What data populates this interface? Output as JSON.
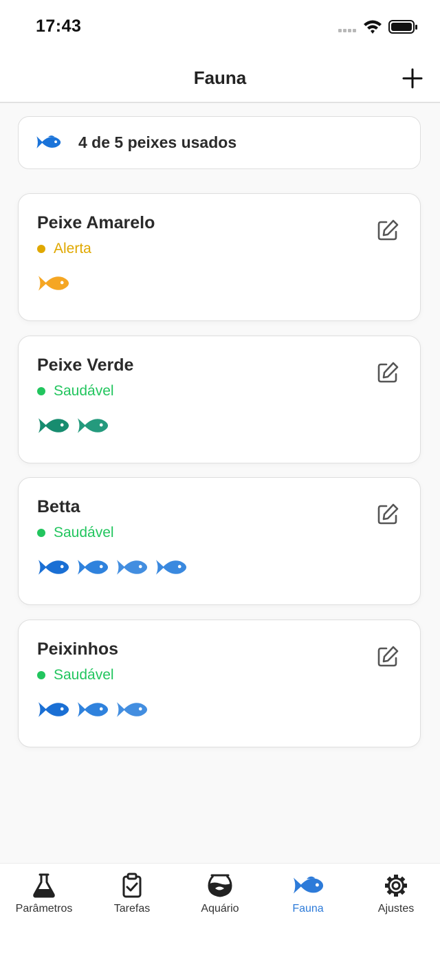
{
  "status_bar": {
    "time": "17:43"
  },
  "header": {
    "title": "Fauna",
    "add_icon": "plus-icon"
  },
  "usage": {
    "text": "4 de 5 peixes usados",
    "icon": "fish-icon",
    "icon_color": "#1a73d9"
  },
  "fauna": [
    {
      "name": "Peixe Amarelo",
      "status": "Alerta",
      "status_color": "#e0a800",
      "fish_count": 1,
      "fish_colors": [
        "#f5a623"
      ]
    },
    {
      "name": "Peixe Verde",
      "status": "Saudável",
      "status_color": "#22c55e",
      "fish_count": 2,
      "fish_colors": [
        "#178c6f",
        "#249a7d"
      ]
    },
    {
      "name": "Betta",
      "status": "Saudável",
      "status_color": "#22c55e",
      "fish_count": 4,
      "fish_colors": [
        "#1a6fd4",
        "#2f82dd",
        "#438ee0",
        "#3a89df"
      ]
    },
    {
      "name": "Peixinhos",
      "status": "Saudável",
      "status_color": "#22c55e",
      "fish_count": 3,
      "fish_colors": [
        "#1a6fd4",
        "#2f82dd",
        "#438ee0"
      ]
    }
  ],
  "tabs": [
    {
      "label": "Parâmetros",
      "icon": "flask-icon",
      "active": false
    },
    {
      "label": "Tarefas",
      "icon": "clipboard-check-icon",
      "active": false
    },
    {
      "label": "Aquário",
      "icon": "fishbowl-icon",
      "active": false
    },
    {
      "label": "Fauna",
      "icon": "fish-icon",
      "active": true
    },
    {
      "label": "Ajustes",
      "icon": "gear-icon",
      "active": false
    }
  ],
  "colors": {
    "accent": "#2d7bd9",
    "card_border": "#dedede",
    "background": "#f9f9f9"
  }
}
